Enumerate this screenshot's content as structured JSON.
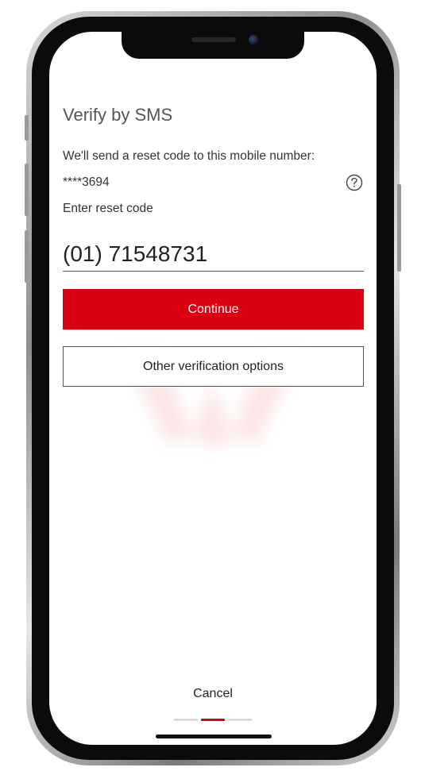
{
  "screen": {
    "title": "Verify by SMS",
    "description": "We'll send a reset code to this mobile number:",
    "masked_number": "****3694",
    "code_label": "Enter reset code",
    "code_value": "(01) 71548731",
    "continue_label": "Continue",
    "other_options_label": "Other verification options",
    "cancel_label": "Cancel"
  },
  "progress": {
    "total_steps": 3,
    "current_step": 2
  },
  "icons": {
    "help": "question-circle-icon",
    "watermark": "brand-watermark-logo"
  },
  "colors": {
    "accent": "#db0011",
    "text": "#333333",
    "title": "#555555",
    "inactive_dot": "#d9d9d9",
    "border": "#555555"
  }
}
